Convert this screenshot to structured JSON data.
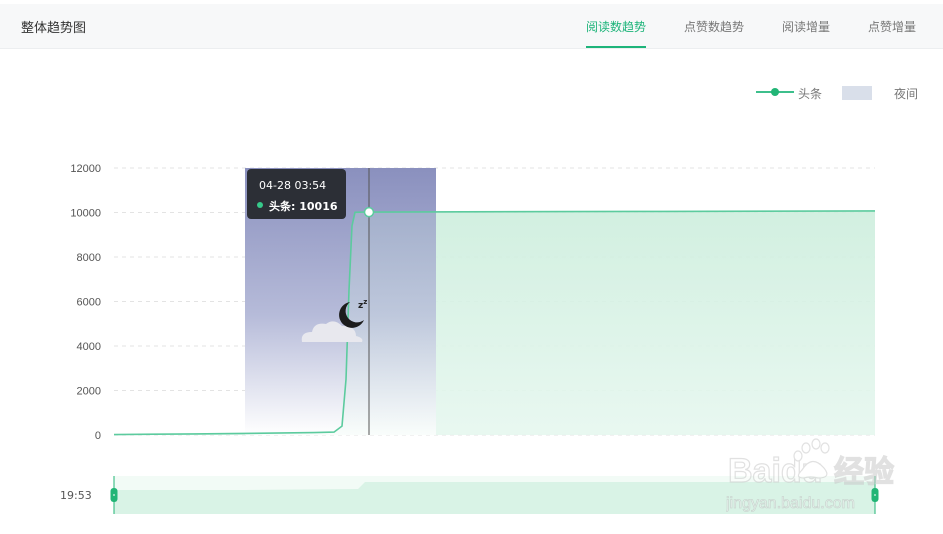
{
  "header": {
    "title": "整体趋势图",
    "tabs": [
      {
        "label": "阅读数趋势",
        "active": true
      },
      {
        "label": "点赞数趋势",
        "active": false
      },
      {
        "label": "阅读增量",
        "active": false
      },
      {
        "label": "点赞增量",
        "active": false
      }
    ]
  },
  "colors": {
    "accent": "#1db47a",
    "series_line": "#5ccb9e",
    "area_fill": "#d4f1e3",
    "night_band": "#8d93bf",
    "tooltip_bg": "#2c2f36"
  },
  "legend": {
    "series_label": "头条",
    "night_label": "夜间"
  },
  "tooltip": {
    "title": "04-28 03:54",
    "series_text": "头条:  10016"
  },
  "slider": {
    "start_time": "19:53"
  },
  "watermark": {
    "brand": "Baidu",
    "cn": "经验",
    "url": "jingyan.baidu.com"
  },
  "chart_data": {
    "type": "area",
    "series": [
      {
        "name": "头条",
        "points": [
          [
            0,
            20
          ],
          [
            40,
            35
          ],
          [
            80,
            50
          ],
          [
            130,
            70
          ],
          [
            170,
            95
          ],
          [
            200,
            110
          ],
          [
            220,
            130
          ],
          [
            228,
            400
          ],
          [
            232,
            2500
          ],
          [
            235,
            6500
          ],
          [
            238,
            9400
          ],
          [
            241,
            10010
          ],
          [
            250,
            10016
          ],
          [
            350,
            10030
          ],
          [
            450,
            10040
          ],
          [
            550,
            10050
          ],
          [
            650,
            10060
          ],
          [
            761,
            10070
          ]
        ]
      }
    ],
    "x_range": [
      0,
      761
    ],
    "ylim": [
      0,
      12000
    ],
    "yticks": [
      "12000",
      "10000",
      "8000",
      "6000",
      "4000",
      "2000",
      "0"
    ],
    "ytick_values": [
      12000,
      10000,
      8000,
      6000,
      4000,
      2000,
      0
    ],
    "night_band_x": [
      131,
      322
    ],
    "crosshair_x": 255,
    "highlight_value": 10016,
    "grid": true,
    "legend_position": "top-right"
  }
}
